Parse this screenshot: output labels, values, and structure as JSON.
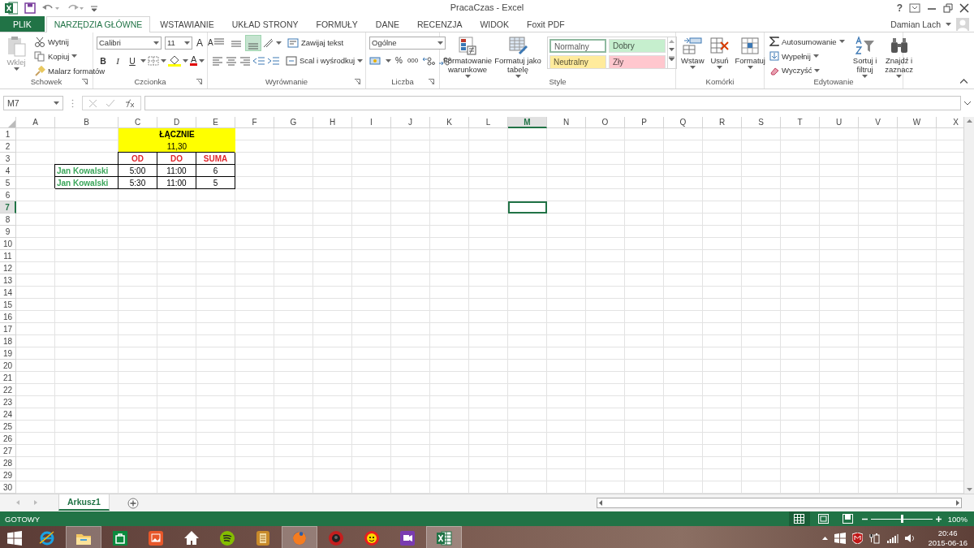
{
  "window": {
    "title": "PracaCzas - Excel",
    "help": "?",
    "user": "Damian Lach"
  },
  "tabs": [
    {
      "label": "PLIK",
      "kind": "file",
      "selected": false
    },
    {
      "label": "NARZĘDZIA GŁÓWNE",
      "kind": "tab",
      "selected": true
    },
    {
      "label": "WSTAWIANIE",
      "kind": "tab",
      "selected": false
    },
    {
      "label": "UKŁAD STRONY",
      "kind": "tab",
      "selected": false
    },
    {
      "label": "FORMUŁY",
      "kind": "tab",
      "selected": false
    },
    {
      "label": "DANE",
      "kind": "tab",
      "selected": false
    },
    {
      "label": "RECENZJA",
      "kind": "tab",
      "selected": false
    },
    {
      "label": "WIDOK",
      "kind": "tab",
      "selected": false
    },
    {
      "label": "Foxit PDF",
      "kind": "tab",
      "selected": false
    }
  ],
  "ribbon": {
    "groups": [
      {
        "kind": "clipboard",
        "label": "Schowek",
        "paste": {
          "label": "Wklej",
          "disabled": true
        },
        "items": [
          "Wytnij",
          "Kopiuj",
          "Malarz formatów"
        ]
      },
      {
        "kind": "font",
        "label": "Czcionka",
        "font": "Calibri",
        "size": "11",
        "size_buttons": [
          "A",
          "A"
        ],
        "style_buttons": [
          "B",
          "I",
          "U"
        ],
        "color_letter": "A"
      },
      {
        "kind": "alignment",
        "label": "Wyrównanie",
        "vertical": [
          {
            "selected": false
          },
          {
            "selected": false
          },
          {
            "selected": true
          }
        ],
        "items": [
          "Zawijaj tekst",
          "Scal i wyśrodkuj"
        ]
      },
      {
        "kind": "number",
        "label": "Liczba",
        "format": "Ogólne",
        "symbols": [
          "%",
          "000"
        ]
      },
      {
        "kind": "styles",
        "label": "Style",
        "buttons": [
          "Formatowanie warunkowe",
          "Formatuj jako tabelę"
        ],
        "styles": [
          {
            "label": "Normalny",
            "color": "#ffffff"
          },
          {
            "label": "Dobry",
            "color": "#c6efce"
          },
          {
            "label": "Neutralny",
            "color": "#ffeb9c"
          },
          {
            "label": "Zły",
            "color": "#ffc7ce"
          }
        ]
      },
      {
        "kind": "cells",
        "label": "Komórki",
        "buttons": [
          "Wstaw",
          "Usuń",
          "Formatuj"
        ]
      },
      {
        "kind": "editing",
        "label": "Edytowanie",
        "items": [
          "Autosumowanie",
          "Wypełnij",
          "Wyczyść"
        ],
        "buttons": [
          "Sortuj i filtruj",
          "Znajdź i zaznacz"
        ]
      }
    ]
  },
  "formula_bar": {
    "name_box": "M7"
  },
  "sheet": {
    "columns": [
      {
        "label": "A",
        "selected": false
      },
      {
        "label": "B",
        "selected": false
      },
      {
        "label": "C",
        "selected": false
      },
      {
        "label": "D",
        "selected": false
      },
      {
        "label": "E",
        "selected": false
      },
      {
        "label": "F",
        "selected": false
      },
      {
        "label": "G",
        "selected": false
      },
      {
        "label": "H",
        "selected": false
      },
      {
        "label": "I",
        "selected": false
      },
      {
        "label": "J",
        "selected": false
      },
      {
        "label": "K",
        "selected": false
      },
      {
        "label": "L",
        "selected": false
      },
      {
        "label": "M",
        "selected": true
      },
      {
        "label": "N",
        "selected": false
      },
      {
        "label": "O",
        "selected": false
      },
      {
        "label": "P",
        "selected": false
      },
      {
        "label": "Q",
        "selected": false
      },
      {
        "label": "R",
        "selected": false
      },
      {
        "label": "S",
        "selected": false
      },
      {
        "label": "T",
        "selected": false
      },
      {
        "label": "U",
        "selected": false
      },
      {
        "label": "V",
        "selected": false
      },
      {
        "label": "W",
        "selected": false
      },
      {
        "label": "X",
        "selected": false
      }
    ],
    "rows": [
      {
        "label": "1",
        "selected": false,
        "cells": [
          null,
          null,
          {
            "text": "ŁĄCZNIE",
            "kind": "title",
            "merged": true
          }
        ]
      },
      {
        "label": "2",
        "selected": false,
        "cells": [
          null,
          null,
          {
            "text": "11,30",
            "kind": "total",
            "merged": true
          }
        ]
      },
      {
        "label": "3",
        "selected": false,
        "cells": [
          null,
          null,
          {
            "text": "OD",
            "kind": "head"
          },
          {
            "text": "DO",
            "kind": "head"
          },
          {
            "text": "SUMA",
            "kind": "head"
          }
        ]
      },
      {
        "label": "4",
        "selected": false,
        "cells": [
          null,
          {
            "text": "Jan Kowalski",
            "kind": "name"
          },
          {
            "text": "5:00",
            "kind": "value"
          },
          {
            "text": "11:00",
            "kind": "value"
          },
          {
            "text": "6",
            "kind": "value"
          }
        ]
      },
      {
        "label": "5",
        "selected": false,
        "cells": [
          null,
          {
            "text": "Jan Kowalski",
            "kind": "name"
          },
          {
            "text": "5:30",
            "kind": "value"
          },
          {
            "text": "11:00",
            "kind": "value"
          },
          {
            "text": "5",
            "kind": "value"
          }
        ]
      },
      {
        "label": "6",
        "selected": false
      },
      {
        "label": "7",
        "selected": true
      },
      {
        "label": "8",
        "selected": false
      },
      {
        "label": "9",
        "selected": false
      },
      {
        "label": "10",
        "selected": false
      },
      {
        "label": "11",
        "selected": false
      },
      {
        "label": "12",
        "selected": false
      },
      {
        "label": "13",
        "selected": false
      },
      {
        "label": "14",
        "selected": false
      },
      {
        "label": "15",
        "selected": false
      },
      {
        "label": "16",
        "selected": false
      },
      {
        "label": "17",
        "selected": false
      },
      {
        "label": "18",
        "selected": false
      },
      {
        "label": "19",
        "selected": false
      },
      {
        "label": "20",
        "selected": false
      },
      {
        "label": "21",
        "selected": false
      },
      {
        "label": "22",
        "selected": false
      },
      {
        "label": "23",
        "selected": false
      },
      {
        "label": "24",
        "selected": false
      },
      {
        "label": "25",
        "selected": false
      },
      {
        "label": "26",
        "selected": false
      },
      {
        "label": "27",
        "selected": false
      },
      {
        "label": "28",
        "selected": false
      },
      {
        "label": "29",
        "selected": false
      },
      {
        "label": "30",
        "selected": false
      }
    ]
  },
  "sheet_tabs": [
    {
      "label": "Arkusz1",
      "selected": true
    }
  ],
  "status_bar": {
    "status": "GOTOWY",
    "views": [
      {
        "selected": true
      },
      {
        "selected": false
      },
      {
        "selected": false
      }
    ],
    "zoom": {
      "level": 0.5
    },
    "zoom_text": "100%"
  },
  "taskbar": {
    "apps": [
      {
        "kind": "ie",
        "open": false
      },
      {
        "kind": "explorer",
        "open": true
      },
      {
        "kind": "store",
        "open": false
      },
      {
        "kind": "photos",
        "open": false
      },
      {
        "kind": "home",
        "open": false
      },
      {
        "kind": "spotify",
        "open": false
      },
      {
        "kind": "notes",
        "open": false
      },
      {
        "kind": "firefox",
        "open": true
      },
      {
        "kind": "camera",
        "open": false
      },
      {
        "kind": "smiley",
        "open": false
      },
      {
        "kind": "media",
        "open": false
      },
      {
        "kind": "excel",
        "open": true
      }
    ],
    "time": "20:46",
    "date": "2015-06-16"
  }
}
